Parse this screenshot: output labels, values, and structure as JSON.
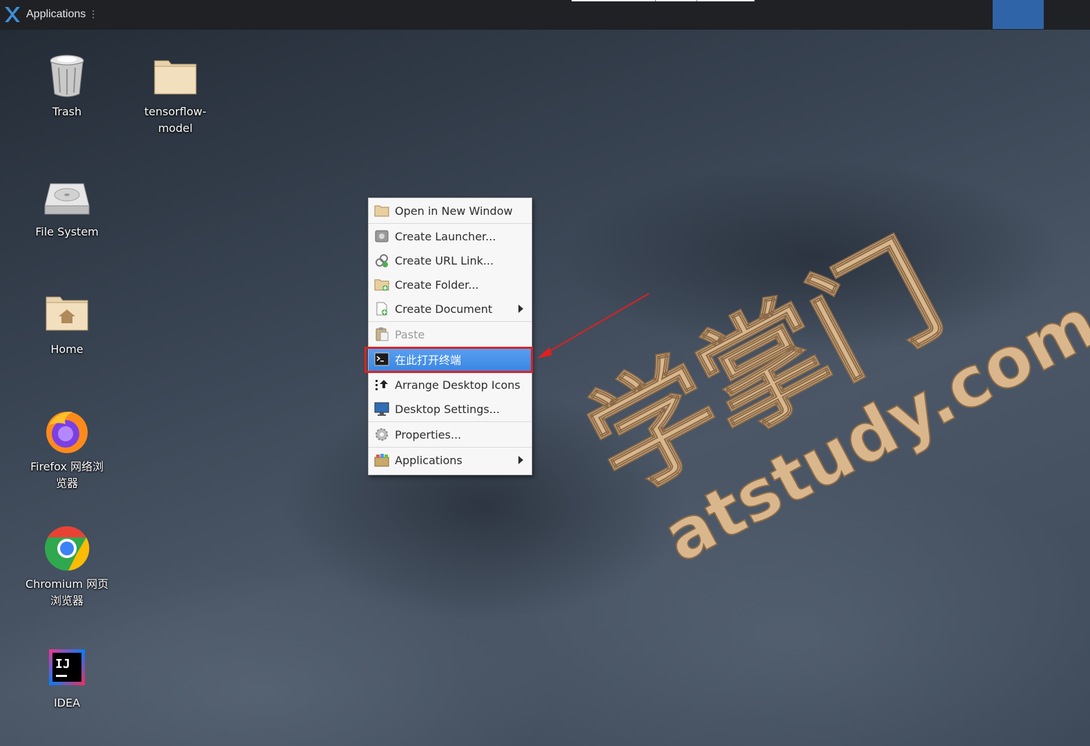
{
  "top_panel": {
    "applications_label": "Applications",
    "menu_dots": "⋮"
  },
  "desktop_icons": [
    {
      "label": "Trash",
      "icon": "trash-icon"
    },
    {
      "label": "tensorflow-\nmodel",
      "icon": "folder-icon"
    },
    {
      "label": "File System",
      "icon": "drive-icon"
    },
    {
      "label": "Home",
      "icon": "home-folder-icon"
    },
    {
      "label": "Firefox 网络浏\n览器",
      "icon": "firefox-icon"
    },
    {
      "label": "Chromium 网页\n浏览器",
      "icon": "chromium-icon"
    },
    {
      "label": "IDEA",
      "icon": "idea-icon"
    }
  ],
  "context_menu": {
    "items": [
      {
        "label": "Open in New Window",
        "icon": "folder-icon"
      },
      {
        "label": "Create Launcher...",
        "icon": "launcher-icon"
      },
      {
        "label": "Create URL Link...",
        "icon": "link-icon"
      },
      {
        "label": "Create Folder...",
        "icon": "new-folder-icon"
      },
      {
        "label": "Create Document",
        "icon": "new-document-icon",
        "submenu": true
      },
      {
        "label": "Paste",
        "icon": "paste-icon",
        "disabled": true
      },
      {
        "label": "在此打开终端",
        "icon": "terminal-icon",
        "highlighted": true
      },
      {
        "label": "Arrange Desktop Icons",
        "icon": "arrange-icon"
      },
      {
        "label": "Desktop Settings...",
        "icon": "monitor-icon"
      },
      {
        "label": "Properties...",
        "icon": "gear-icon"
      },
      {
        "label": "Applications",
        "icon": "applications-icon",
        "submenu": true
      }
    ]
  },
  "wallpaper": {
    "logo_text": "学掌门",
    "domain_text": "atstudy.com"
  },
  "colors": {
    "menu_highlight": "#3a86e2",
    "annotation_red": "#e02020",
    "panel_bg": "#1f2125"
  }
}
